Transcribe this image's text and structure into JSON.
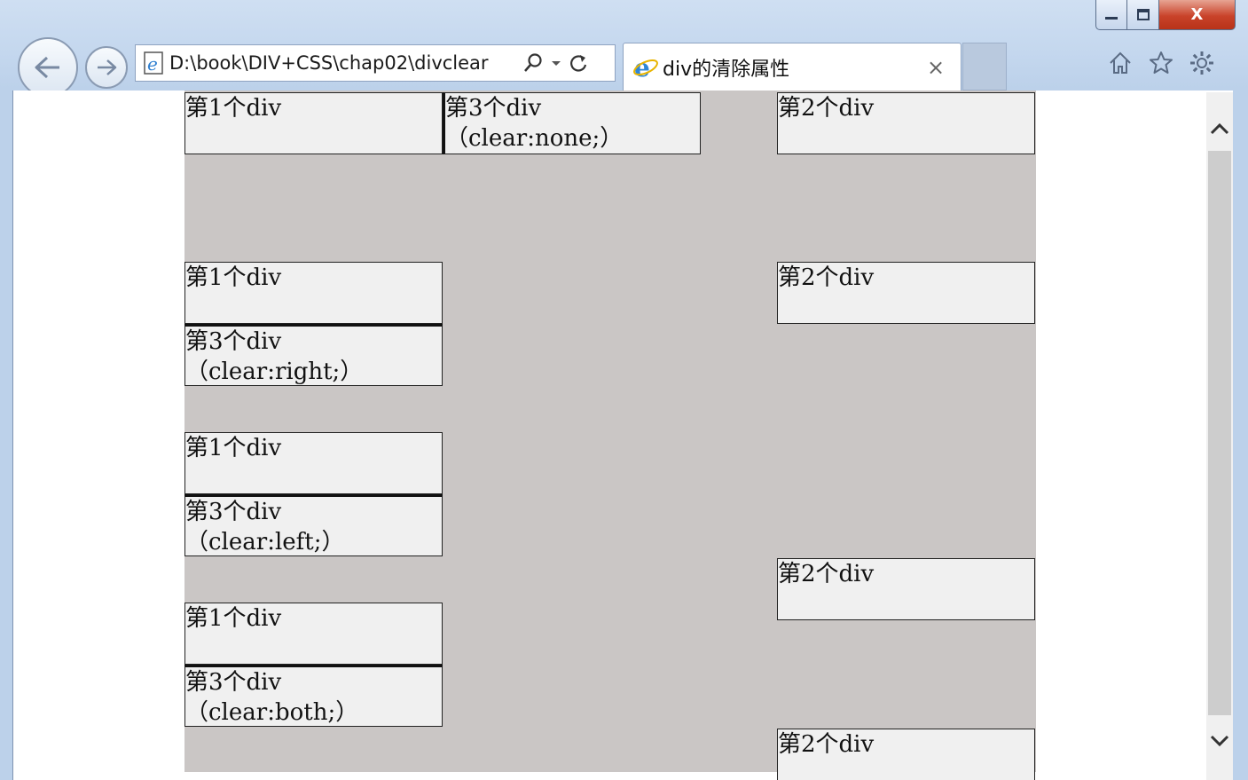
{
  "window": {
    "min_label": "",
    "max_label": "",
    "close_label": "X"
  },
  "address": {
    "url": "D:\\book\\DIV+CSS\\chap02\\divclear"
  },
  "tab": {
    "title": "div的清除属性",
    "close": "×"
  },
  "icons": {
    "back": "back-arrow-icon",
    "forward": "forward-arrow-icon",
    "search": "search-icon",
    "dropdown": "dropdown-icon",
    "refresh": "refresh-icon",
    "home": "home-icon",
    "favorites": "star-icon",
    "settings": "gear-icon"
  },
  "colors": {
    "container_bg": "#cac6c5",
    "box_bg": "#f0f0f0"
  },
  "page": {
    "row1": {
      "div1": "第1个div",
      "div3": "第3个div\n（clear:none;）",
      "div2": "第2个div"
    },
    "row2": {
      "div1": "第1个div",
      "div3": "第3个div\n（clear:right;）",
      "div2": "第2个div"
    },
    "row3": {
      "div1": "第1个div",
      "div3": "第3个div\n（clear:left;）",
      "div2": "第2个div"
    },
    "row4": {
      "div1": "第1个div",
      "div3": "第3个div\n（clear:both;）",
      "div2": "第2个div"
    }
  }
}
